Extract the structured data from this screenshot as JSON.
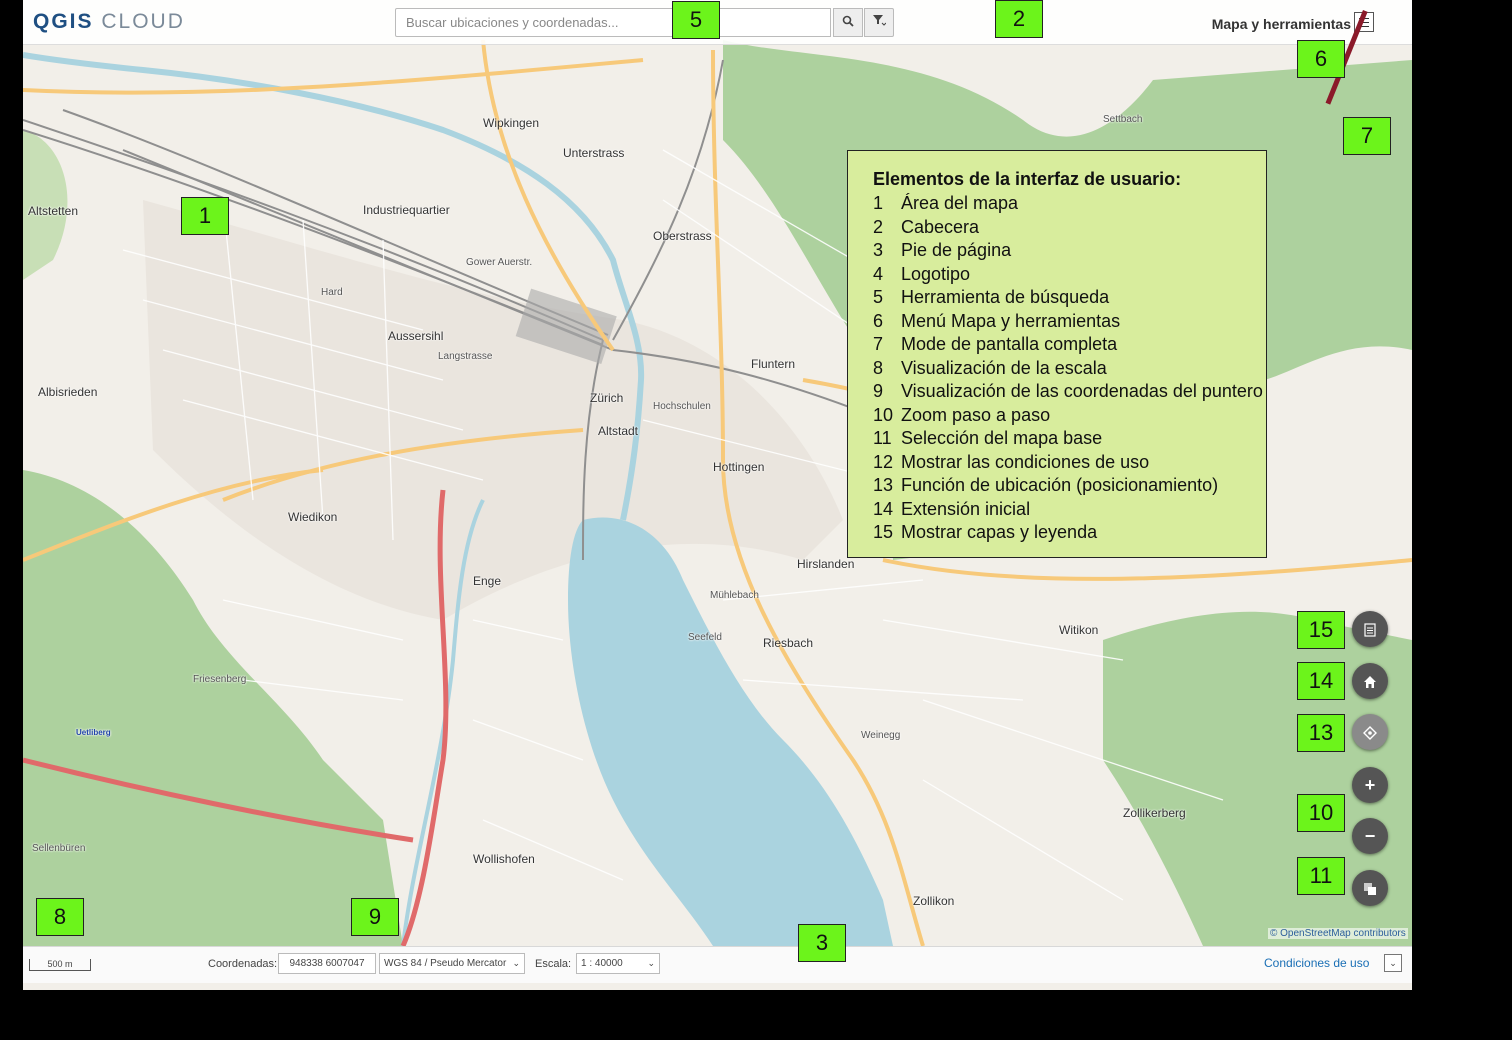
{
  "header": {
    "logo_main": "QGIS",
    "logo_rest": " CLOUD",
    "search_placeholder": "Buscar ubicaciones y coordenadas...",
    "menu_label": "Mapa y herramientas"
  },
  "map": {
    "places": [
      {
        "t": "Wipkingen"
      },
      {
        "t": "Unterstrass"
      },
      {
        "t": "Oberstrass"
      },
      {
        "t": "Industriequartier"
      },
      {
        "t": "Altstetten"
      },
      {
        "t": "Hard"
      },
      {
        "t": "Aussersihl"
      },
      {
        "t": "Langstrasse"
      },
      {
        "t": "Albisrieden"
      },
      {
        "t": "Zürich"
      },
      {
        "t": "Altstadt"
      },
      {
        "t": "Hochschulen"
      },
      {
        "t": "Fluntern"
      },
      {
        "t": "Hottingen"
      },
      {
        "t": "Wiedikon"
      },
      {
        "t": "Enge"
      },
      {
        "t": "Mühlebach"
      },
      {
        "t": "Hirslanden"
      },
      {
        "t": "Seefeld"
      },
      {
        "t": "Riesbach"
      },
      {
        "t": "Witikon"
      },
      {
        "t": "Friesenberg"
      },
      {
        "t": "Wollishofen"
      },
      {
        "t": "Zollikon"
      },
      {
        "t": "Zollikerberg"
      },
      {
        "t": "Weinegg"
      },
      {
        "t": "Uetliberg"
      },
      {
        "t": "Sellenbüren"
      },
      {
        "t": "Settbach"
      },
      {
        "t": "Gower Auerstr."
      }
    ],
    "attribution": "© OpenStreetMap contributors"
  },
  "footer": {
    "scale_bar": "500 m",
    "coord_label": "Coordenadas:",
    "coord_value": "948338 6007047",
    "crs_value": "WGS 84 / Pseudo Mercator",
    "scale_label": "Escala:",
    "scale_value": "1 : 40000",
    "terms_link": "Condiciones de uso"
  },
  "controls": {
    "layers_icon": "layers-list-icon",
    "home_icon": "home-icon",
    "locate_icon": "locate-icon",
    "zoom_in": "+",
    "zoom_out": "−",
    "basemap_icon": "basemap-icon"
  },
  "annotations": {
    "title": "Elementos de la interfaz de usuario:",
    "items": [
      {
        "n": "1",
        "label": "Área del mapa"
      },
      {
        "n": "2",
        "label": "Cabecera"
      },
      {
        "n": "3",
        "label": "Pie de página"
      },
      {
        "n": "4",
        "label": "Logotipo"
      },
      {
        "n": "5",
        "label": "Herramienta de búsqueda"
      },
      {
        "n": "6",
        "label": "Menú Mapa y herramientas"
      },
      {
        "n": "7",
        "label": "Mode de pantalla completa"
      },
      {
        "n": "8",
        "label": "Visualización de la escala"
      },
      {
        "n": "9",
        "label": "Visualización de las coordenadas del puntero"
      },
      {
        "n": "10",
        "label": "Zoom paso a paso"
      },
      {
        "n": "11",
        "label": "Selección del mapa base"
      },
      {
        "n": "12",
        "label": "Mostrar las condiciones de uso"
      },
      {
        "n": "13",
        "label": "Función de ubicación (posicionamiento)"
      },
      {
        "n": "14",
        "label": "Extensión inicial"
      },
      {
        "n": "15",
        "label": "Mostrar capas y leyenda"
      }
    ],
    "tags": [
      "1",
      "2",
      "3",
      "5",
      "6",
      "7",
      "8",
      "9",
      "10",
      "11",
      "13",
      "14",
      "15"
    ]
  },
  "colors": {
    "tag_green": "#6cf41b",
    "legend_bg": "#d8ed9d",
    "lake": "#aad3df",
    "forest": "#add19e",
    "link": "#1a6fb5"
  }
}
